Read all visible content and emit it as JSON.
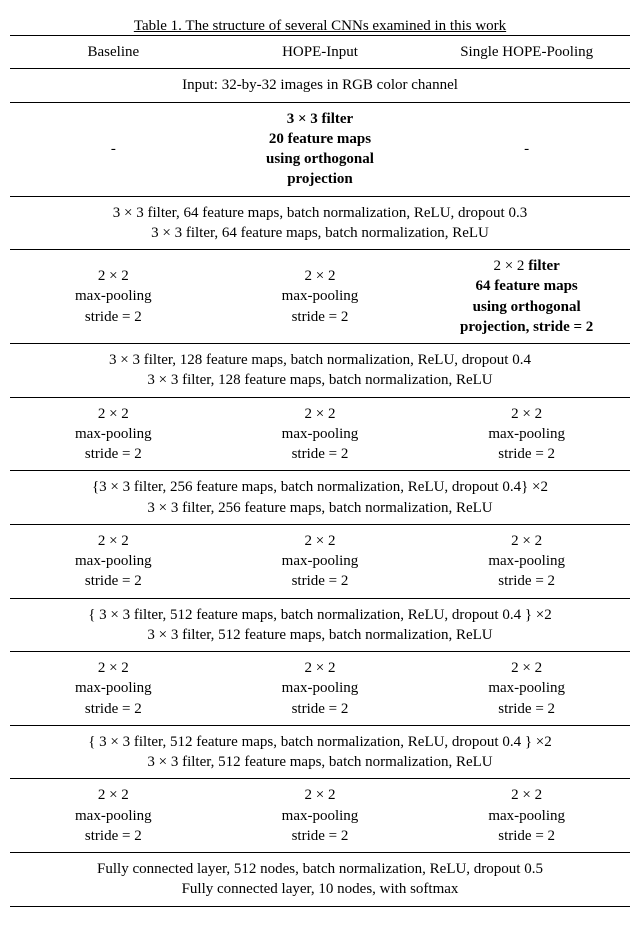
{
  "caption": "Table 1. The structure of several CNNs examined in this work",
  "headers": {
    "c1": "Baseline",
    "c2": "HOPE-Input",
    "c3": "Single HOPE-Pooling"
  },
  "input_row": "Input: 32-by-32 images in RGB color channel",
  "hope_input": {
    "l1": "3 × 3 filter",
    "l2": "20 feature maps",
    "l3": "using orthogonal",
    "l4": "projection"
  },
  "dash": "-",
  "conv_block1": {
    "a": "3 × 3 filter, 64 feature maps, batch normalization, ReLU, dropout 0.3",
    "b": "3 × 3 filter, 64 feature maps, batch normalization, ReLU"
  },
  "pool_std": {
    "l1": "2 × 2",
    "l2": "max-pooling",
    "l3": "stride = 2"
  },
  "hope_pool": {
    "l1": "2 × 2 filter",
    "l2": "64 feature maps",
    "l3": "using orthogonal",
    "l4": "projection, stride = 2"
  },
  "conv_block2": {
    "a": "3 × 3 filter, 128 feature maps, batch normalization, ReLU, dropout 0.4",
    "b": "3 × 3 filter, 128 feature maps, batch normalization, ReLU"
  },
  "conv_block3": {
    "a": "{3 × 3 filter, 256 feature maps, batch normalization, ReLU, dropout 0.4} ×2",
    "b": "3 × 3 filter, 256 feature maps, batch normalization, ReLU"
  },
  "conv_block4": {
    "a": "{ 3 × 3 filter, 512 feature maps, batch normalization, ReLU, dropout 0.4 } ×2",
    "b": "3 × 3 filter, 512 feature maps, batch normalization, ReLU"
  },
  "conv_block5": {
    "a": "{ 3 × 3 filter, 512 feature maps, batch normalization, ReLU, dropout 0.4 } ×2",
    "b": "3 × 3 filter, 512 feature maps, batch normalization, ReLU"
  },
  "fc": {
    "a": "Fully connected layer, 512 nodes, batch normalization, ReLU, dropout 0.5",
    "b": "Fully connected layer, 10 nodes, with softmax"
  }
}
